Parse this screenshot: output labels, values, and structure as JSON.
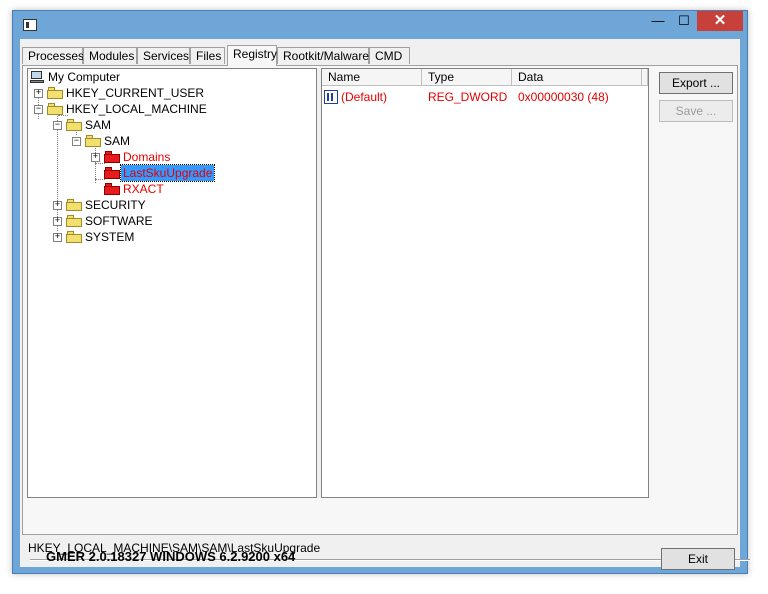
{
  "window": {
    "minimize_glyph": "—",
    "maximize_glyph": "☐",
    "close_glyph": "✕"
  },
  "tabs": [
    {
      "label": "Processes"
    },
    {
      "label": "Modules"
    },
    {
      "label": "Services"
    },
    {
      "label": "Files"
    },
    {
      "label": "Registry",
      "active": true
    },
    {
      "label": "Rootkit/Malware"
    },
    {
      "label": "CMD"
    }
  ],
  "tree": {
    "root": "My Computer",
    "hkcu": "HKEY_CURRENT_USER",
    "hklm": "HKEY_LOCAL_MACHINE",
    "sam1": "SAM",
    "sam2": "SAM",
    "domains": "Domains",
    "lastsku": "LastSkuUpgrade",
    "rxact": "RXACT",
    "security": "SECURITY",
    "software": "SOFTWARE",
    "system": "SYSTEM",
    "plus": "+",
    "minus": "−"
  },
  "values_table": {
    "columns": [
      "Name",
      "Type",
      "Data"
    ],
    "rows": [
      {
        "name": "(Default)",
        "type": "REG_DWORD",
        "data": "0x00000030 (48)"
      }
    ]
  },
  "buttons": {
    "export": "Export ...",
    "save": "Save ...",
    "exit": "Exit"
  },
  "current_path": "HKEY_LOCAL_MACHINE\\SAM\\SAM\\LastSkuUpgrade",
  "version_text": "GMER 2.0.18327     WINDOWS 6.2.9200  x64"
}
